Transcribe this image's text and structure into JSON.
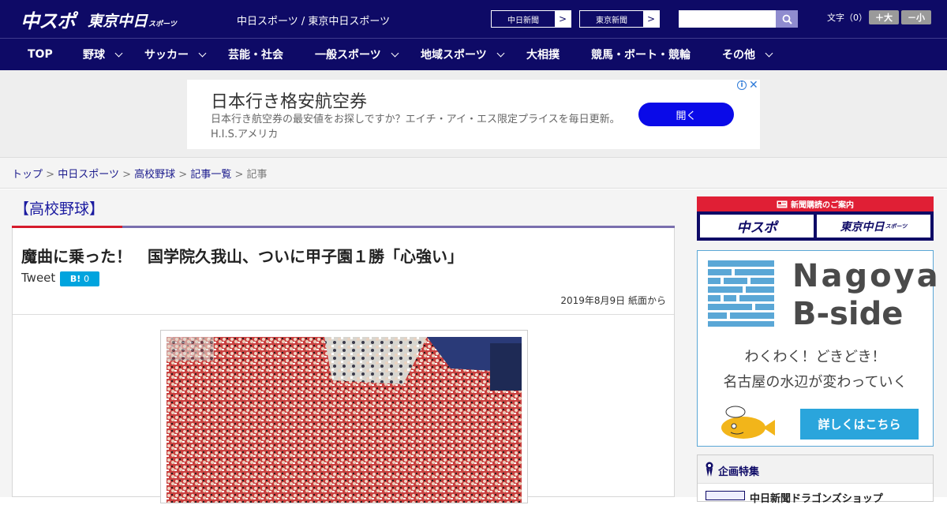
{
  "header": {
    "logo_main": "中スポ",
    "logo_tokyo": "東京中日",
    "logo_tokyo_sub": "スポーツ",
    "site_names": "中日スポーツ / 東京中日スポーツ",
    "link_chunichi": "中日新聞",
    "link_tokyo": "東京新聞",
    "arrow": ">",
    "search_placeholder": "",
    "font_size_label": "文字（0）",
    "font_larger": "＋大",
    "font_smaller": "－小"
  },
  "nav": {
    "items": [
      {
        "label": "TOP",
        "dropdown": false
      },
      {
        "label": "野球",
        "dropdown": true
      },
      {
        "label": "サッカー",
        "dropdown": true
      },
      {
        "label": "芸能・社会",
        "dropdown": false
      },
      {
        "label": "一般スポーツ",
        "dropdown": true
      },
      {
        "label": "地域スポーツ",
        "dropdown": true
      },
      {
        "label": "大相撲",
        "dropdown": false
      },
      {
        "label": "競馬・ボート・競輪",
        "dropdown": false
      },
      {
        "label": "その他",
        "dropdown": true
      }
    ]
  },
  "ad": {
    "title": "日本行き格安航空券",
    "description": "日本行き航空券の最安値をお探しですか？エイチ・アイ・エス限定プライスを毎日更新。 H.I.S.アメリカ",
    "button": "開く",
    "info": "i",
    "close": "✕"
  },
  "breadcrumb": {
    "items": [
      "トップ",
      "中日スポーツ",
      "高校野球",
      "記事一覧"
    ],
    "current": "記事",
    "separator": ">"
  },
  "category": {
    "title": "【高校野球】"
  },
  "article": {
    "title": "魔曲に乗った！　国学院久我山、ついに甲子園１勝「心強い」",
    "tweet": "Tweet",
    "hatena_label": "B!",
    "hatena_count": "0",
    "date": "2019年8月9日 紙面から"
  },
  "sidebar": {
    "subscribe_header": "新聞購読のご案内",
    "subscribe_a": "中スポ",
    "subscribe_b": "東京中日",
    "subscribe_b_sub": "スポーツ",
    "bside_line1": "Nagoya",
    "bside_line2": "B-side",
    "bside_text1": "わくわく！どきどき！",
    "bside_text2": "名古屋の水辺が変わっていく",
    "bside_button": "詳しくはこちら",
    "kikaku_title": "企画特集",
    "kikaku_item": "中日新聞ドラゴンズショップ"
  },
  "colors": {
    "header_bg": "#0e0a66",
    "accent_red": "#d61c2c",
    "ad_button": "#0a0ae8",
    "bside_button": "#2aa5dc",
    "hatena": "#00a4de"
  }
}
